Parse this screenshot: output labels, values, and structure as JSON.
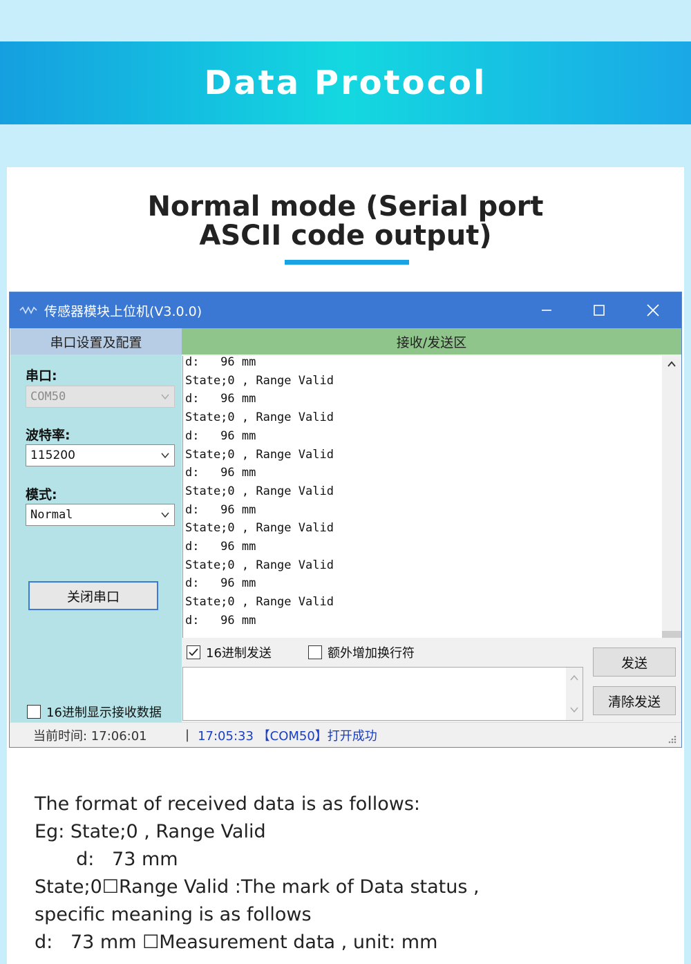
{
  "banner": {
    "title": "Data Protocol"
  },
  "heading": {
    "line1": "Normal mode (Serial port",
    "line2": "ASCII code output)"
  },
  "window": {
    "title": "传感器模块上位机(V3.0.0)",
    "controls": {
      "minimize": "—",
      "maximize": "☐",
      "close": "✕"
    },
    "left_panel": {
      "header": "串口设置及配置",
      "port_label": "串口:",
      "port_value": "COM50",
      "baud_label": "波特率:",
      "baud_value": "115200",
      "mode_label": "模式:",
      "mode_value": "Normal",
      "close_port_button": "关闭串口",
      "hex_display_checkbox": "16进制显示接收数据"
    },
    "right_panel": {
      "header": "接收/发送区",
      "received_lines": [
        "d:   96 mm",
        "State;0 , Range Valid",
        "d:   96 mm",
        "State;0 , Range Valid",
        "d:   96 mm",
        "State;0 , Range Valid",
        "d:   96 mm",
        "State;0 , Range Valid",
        "d:   96 mm",
        "State;0 , Range Valid",
        "d:   96 mm",
        "State;0 , Range Valid",
        "d:   96 mm",
        "State;0 , Range Valid",
        "d:   96 mm"
      ],
      "hex_send_checkbox": "16进制发送",
      "hex_send_checked": true,
      "extra_newline_checkbox": "额外增加换行符",
      "extra_newline_checked": false,
      "send_button": "发送",
      "clear_send_button": "清除发送"
    },
    "status": {
      "current_time": "当前时间: 17:06:01",
      "separator": "|",
      "message": "17:05:33 【COM50】打开成功"
    }
  },
  "description": {
    "lines": [
      "The format of received data is as follows:",
      "Eg: State;0 , Range Valid",
      "       d:   73 mm",
      "State;0☐Range Valid :The mark of Data status ,",
      "specific meaning is as follows",
      "d:   73 mm ☐Measurement data , unit: mm"
    ]
  },
  "colors": {
    "banner_start": "#159fe0",
    "banner_mid": "#14d8e0",
    "accent_underline": "#1aa3e4",
    "titlebar": "#3b78d3",
    "left_panel": "#b4e2e6",
    "right_header": "#8fc58a",
    "status_message": "#1a3fc4"
  }
}
